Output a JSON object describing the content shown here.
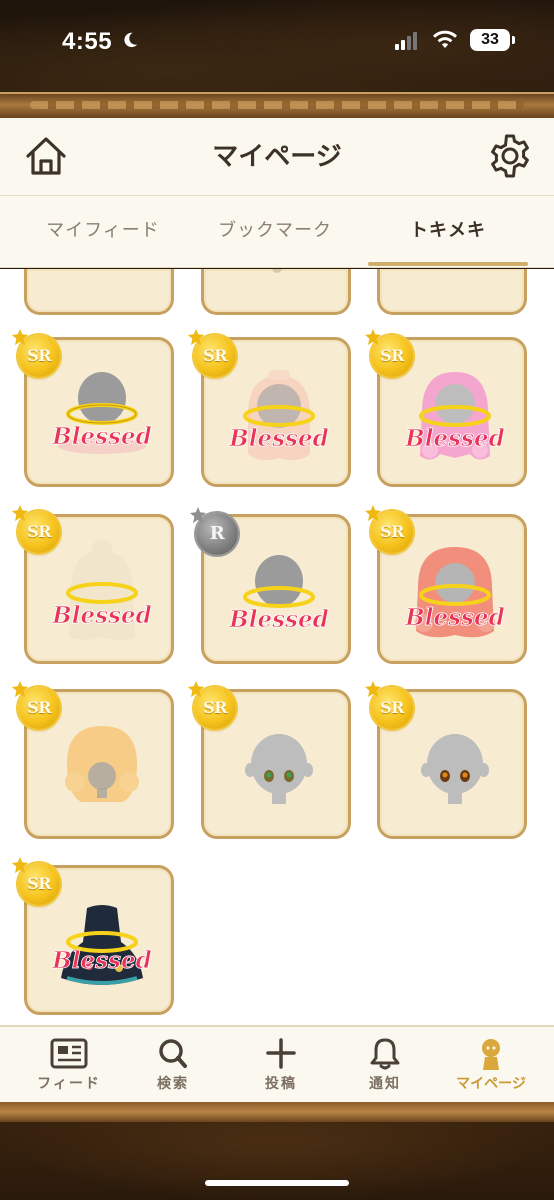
{
  "status_bar": {
    "time": "4:55",
    "battery": "33"
  },
  "header": {
    "title": "マイページ"
  },
  "tabs": [
    {
      "label": "マイフィード",
      "active": false
    },
    {
      "label": "ブックマーク",
      "active": false
    },
    {
      "label": "トキメキ",
      "active": true
    }
  ],
  "items": [
    {
      "rarity": "SR",
      "overlay": "Blessed",
      "art": "head-bald"
    },
    {
      "rarity": "SR",
      "overlay": "Blessed",
      "art": "hair-pink-bow"
    },
    {
      "rarity": "SR",
      "overlay": "Blessed",
      "art": "hair-pink-curly"
    },
    {
      "rarity": "SR",
      "overlay": "Blessed",
      "art": "hair-cream"
    },
    {
      "rarity": "R",
      "overlay": "Blessed",
      "art": "head-bald"
    },
    {
      "rarity": "SR",
      "overlay": "Blessed",
      "art": "hair-coral"
    },
    {
      "rarity": "SR",
      "overlay": "",
      "art": "hair-orange"
    },
    {
      "rarity": "SR",
      "overlay": "",
      "art": "face-green-eyes"
    },
    {
      "rarity": "SR",
      "overlay": "",
      "art": "face-amber-eyes"
    },
    {
      "rarity": "SR",
      "overlay": "Blessed",
      "art": "dress-dark"
    }
  ],
  "bottom_nav": [
    {
      "label": "フィード",
      "icon": "newspaper-icon",
      "active": false
    },
    {
      "label": "検索",
      "icon": "search-icon",
      "active": false
    },
    {
      "label": "投稿",
      "icon": "plus-icon",
      "active": false
    },
    {
      "label": "通知",
      "icon": "bell-icon",
      "active": false
    },
    {
      "label": "マイページ",
      "icon": "mypage-avatar-icon",
      "active": true
    }
  ],
  "colors": {
    "accent": "#cfae6c",
    "card_bg": "#f7ecd1",
    "card_border": "#c8a160",
    "blessed_text": "#e8335a",
    "halo": "#f6d21a"
  }
}
